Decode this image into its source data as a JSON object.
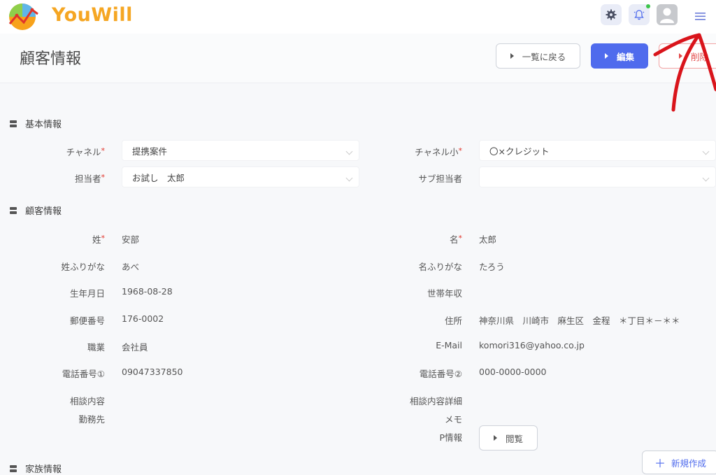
{
  "app": {
    "name": "YouWill"
  },
  "header": {
    "title": "顧客情報",
    "back_label": "一覧に戻る",
    "edit_label": "編集",
    "delete_label": "削除"
  },
  "sections": {
    "basic": "基本情報",
    "customer": "顧客情報",
    "family": "家族情報"
  },
  "basic": {
    "channel_label": "チャネル",
    "channel_value": "提携案件",
    "channel_sub_label": "チャネル小",
    "channel_sub_value": "〇×クレジット",
    "staff_label": "担当者",
    "staff_value": "お試し　太郎",
    "sub_staff_label": "サブ担当者",
    "sub_staff_value": ""
  },
  "customer": {
    "last_name_label": "姓",
    "last_name": "安部",
    "first_name_label": "名",
    "first_name": "太郎",
    "last_kana_label": "姓ふりがな",
    "last_kana": "あべ",
    "first_kana_label": "名ふりがな",
    "first_kana": "たろう",
    "birth_label": "生年月日",
    "birth": "1968-08-28",
    "income_label": "世帯年収",
    "income": "",
    "zip_label": "郵便番号",
    "zip": "176-0002",
    "address_label": "住所",
    "address": "神奈川県　川崎市　麻生区　金程　＊丁目＊－＊＊",
    "job_label": "職業",
    "job": "会社員",
    "email_label": "E-Mail",
    "email": "komori316@yahoo.co.jp",
    "phone1_label": "電話番号①",
    "phone1": "09047337850",
    "phone2_label": "電話番号②",
    "phone2": "000-0000-0000",
    "consult_label": "相談内容",
    "consult_detail_label": "相談内容詳細",
    "workplace_label": "勤務先",
    "memo_label": "メモ",
    "p_info_label": "P情報",
    "view_label": "閲覧"
  },
  "actions": {
    "new_label": "新規作成"
  },
  "colors": {
    "primary": "#4f6bed",
    "danger": "#e24a4a",
    "logo": "#f5a623",
    "annotation": "#d9141b"
  }
}
